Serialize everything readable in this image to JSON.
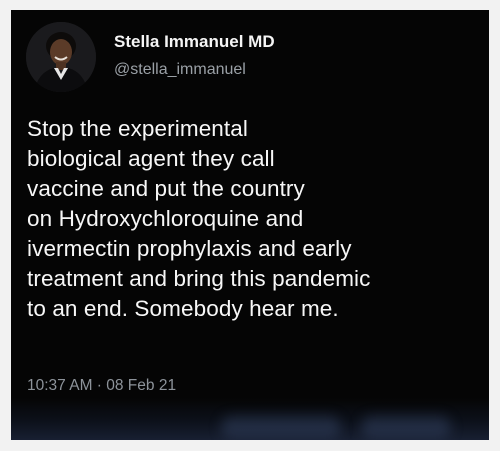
{
  "tweet": {
    "author": {
      "display_name": "Stella Immanuel MD",
      "handle": "@stella_immanuel",
      "avatar_icon": "profile-photo"
    },
    "text_lines": [
      "Stop the experimental",
      "biological agent they call",
      "vaccine and put the country",
      "on Hydroxychloroquine and",
      "ivermectin prophylaxis and early",
      "treatment and bring this pandemic",
      "to an end. Somebody hear me."
    ],
    "timestamp": "10:37 AM · 08 Feb 21"
  },
  "colors": {
    "background": "#050505",
    "name_text": "#f5f5f5",
    "secondary_text": "#9aa0a6",
    "body_text": "#f7f7f7"
  }
}
